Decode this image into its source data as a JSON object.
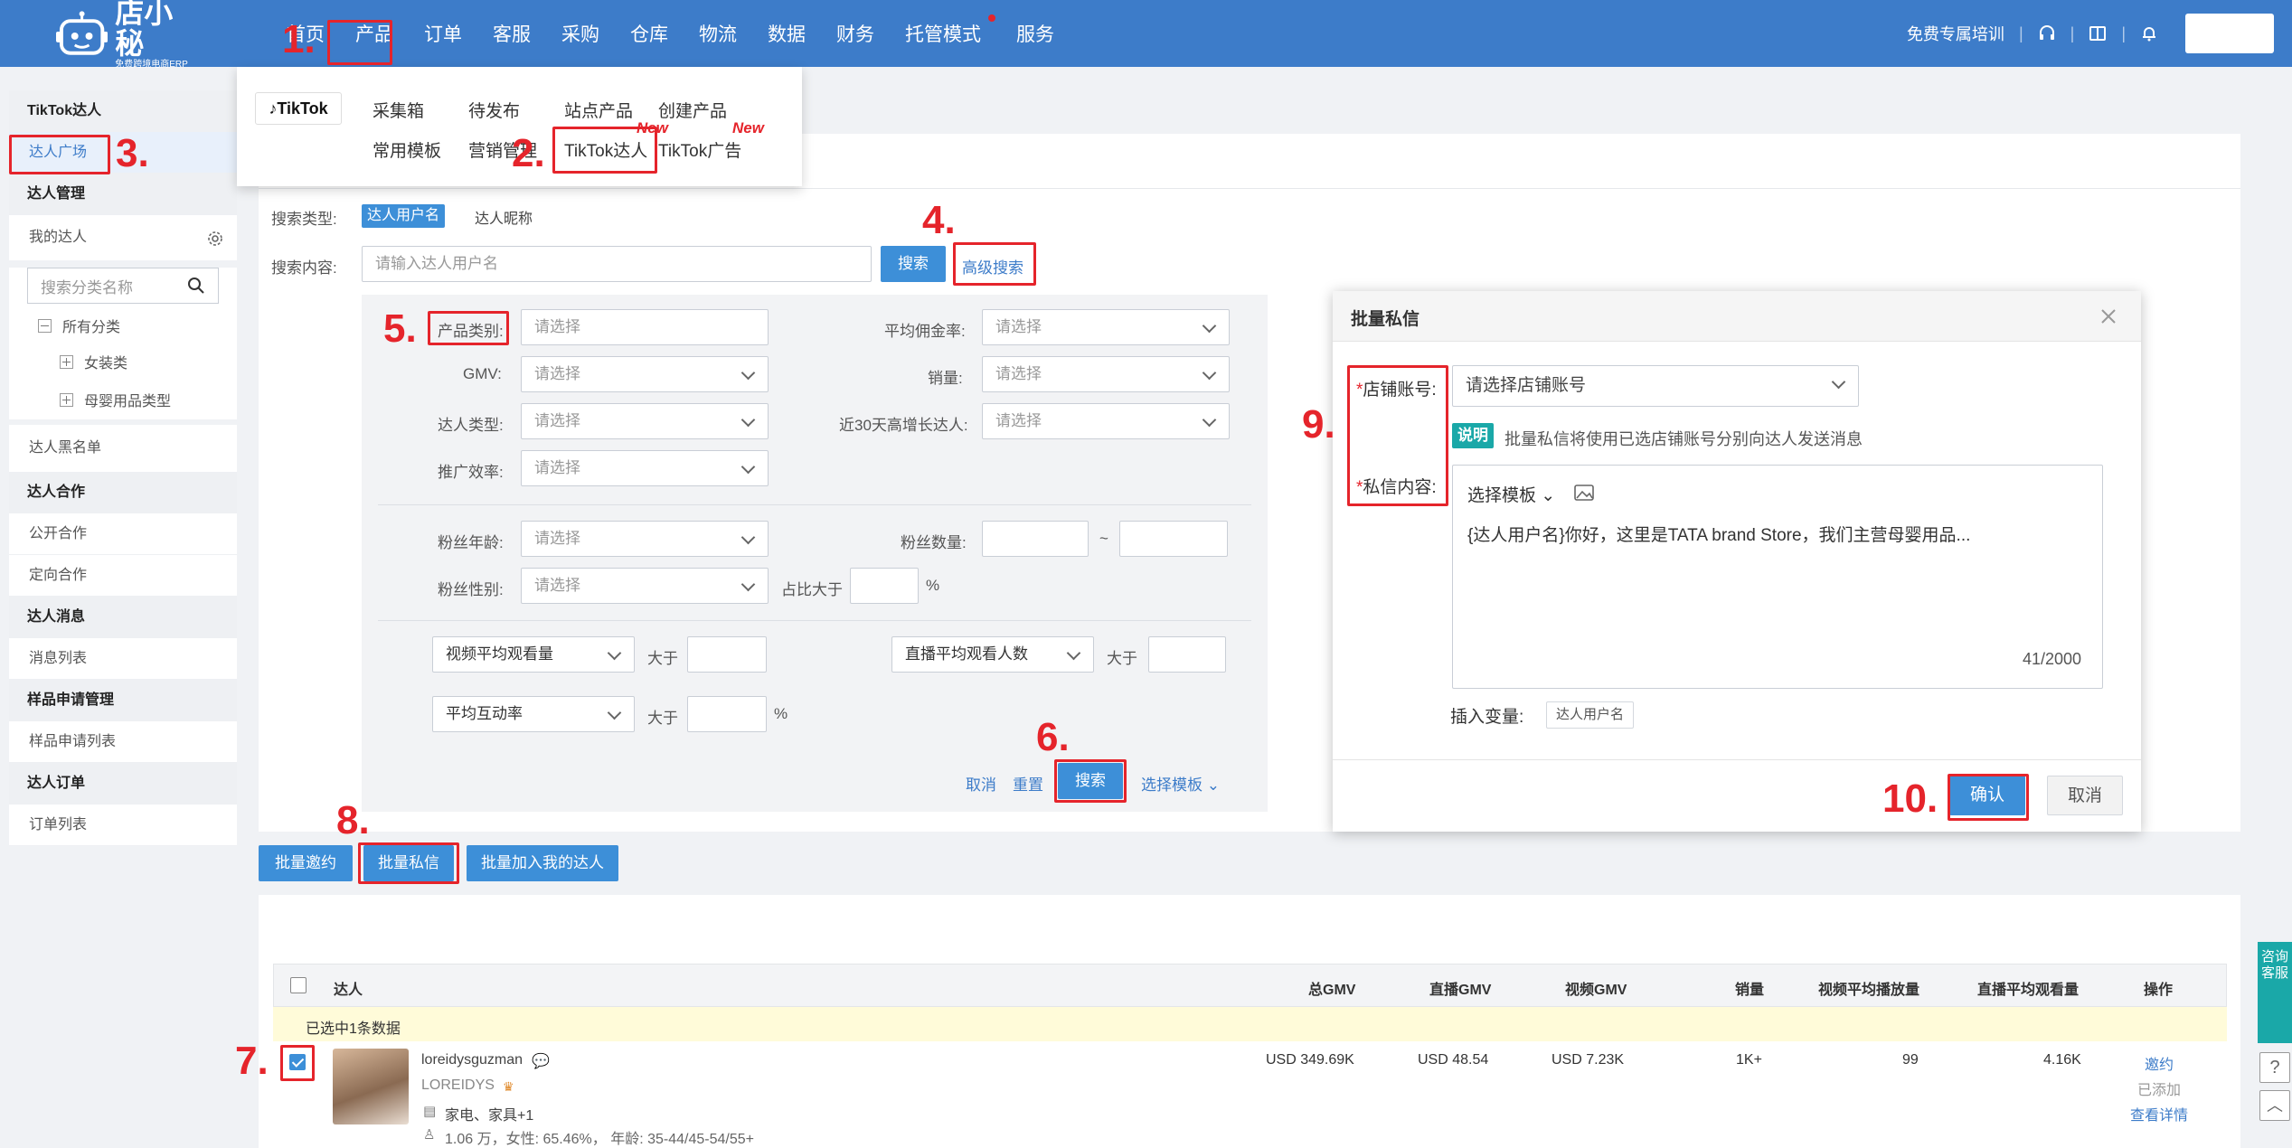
{
  "header": {
    "logo_text": "店小秘",
    "logo_sub": "免费跨境电商ERP",
    "nav": [
      "首页",
      "产品",
      "订单",
      "客服",
      "采购",
      "仓库",
      "物流",
      "数据",
      "财务",
      "托管模式",
      "服务"
    ],
    "training": "免费专属培训"
  },
  "dropdown": {
    "tiktok_label": "TikTok",
    "items": [
      "采集箱",
      "待发布",
      "站点产品",
      "创建产品",
      "常用模板",
      "营销管理",
      "TikTok达人",
      "TikTok广告"
    ],
    "new_badge": "New"
  },
  "sidebar": {
    "sections": [
      {
        "title": "TikTok达人",
        "items": [
          "达人广场"
        ]
      },
      {
        "title": "达人管理",
        "items": [
          "我的达人"
        ]
      },
      {
        "title": "达人合作",
        "items": [
          "公开合作",
          "定向合作"
        ]
      },
      {
        "title": "达人消息",
        "items": [
          "消息列表"
        ]
      },
      {
        "title": "样品申请管理",
        "items": [
          "样品申请列表"
        ]
      },
      {
        "title": "达人订单",
        "items": [
          "订单列表"
        ]
      }
    ],
    "search_placeholder": "搜索分类名称",
    "tree": [
      "所有分类",
      "女装类",
      "母婴用品类型"
    ],
    "blacklist": "达人黑名单"
  },
  "search": {
    "type_label": "搜索类型:",
    "type_active": "达人用户名",
    "type_other": "达人昵称",
    "content_label": "搜索内容:",
    "placeholder": "请输入达人用户名",
    "search_btn": "搜索",
    "advanced": "高级搜索"
  },
  "filters": {
    "select_ph": "请选择",
    "product_category": "产品类别:",
    "gmv": "GMV:",
    "creator_type": "达人类型:",
    "promo_eff": "推广效率:",
    "avg_commission": "平均佣金率:",
    "sales": "销量:",
    "growth": "近30天高增长达人:",
    "fan_age": "粉丝年龄:",
    "fan_gender": "粉丝性别:",
    "fan_count": "粉丝数量:",
    "tilde": "~",
    "ratio_gt": "占比大于",
    "pct": "%",
    "video_avg": "视频平均观看量",
    "live_avg": "直播平均观看人数",
    "avg_interact": "平均互动率",
    "gt": "大于",
    "cancel": "取消",
    "reset": "重置",
    "search": "搜索",
    "template": "选择模板"
  },
  "actions": [
    "批量邀约",
    "批量私信",
    "批量加入我的达人"
  ],
  "modal": {
    "title": "批量私信",
    "shop_label": "店铺账号:",
    "shop_ph": "请选择店铺账号",
    "note_badge": "说明",
    "note": "批量私信将使用已选店铺账号分别向达人发送消息",
    "content_label": "私信内容:",
    "template": "选择模板",
    "message": "{达人用户名}你好，这里是TATA brand Store，我们主营母婴用品...",
    "counter": "41/2000",
    "insert_label": "插入变量:",
    "insert_tag": "达人用户名",
    "confirm": "确认",
    "cancel": "取消"
  },
  "table": {
    "headers": [
      "达人",
      "总GMV",
      "直播GMV",
      "视频GMV",
      "销量",
      "视频平均播放量",
      "直播平均观看量",
      "操作"
    ],
    "selected_note": "已选中1条数据",
    "row": {
      "username": "loreidysguzman",
      "nickname": "LOREIDYS",
      "category": "家电、家具+1",
      "stats": "1.06 万，女性: 65.46%， 年龄: 35-44/45-54/55+",
      "total_gmv": "USD 349.69K",
      "live_gmv": "USD 48.54",
      "video_gmv": "USD 7.23K",
      "sales": "1K+",
      "video_avg": "99",
      "live_avg": "4.16K",
      "invite": "邀约",
      "added": "已添加",
      "detail": "查看详情"
    }
  },
  "float": {
    "consult": "咨询客服"
  },
  "steps": [
    "1.",
    "2.",
    "3.",
    "4.",
    "5.",
    "6.",
    "7.",
    "8.",
    "9.",
    "10."
  ],
  "colors": {
    "primary": "#3d7cc9",
    "button": "#3d8fd8",
    "annotation": "#e5242b",
    "teal": "#1aa8a8"
  }
}
